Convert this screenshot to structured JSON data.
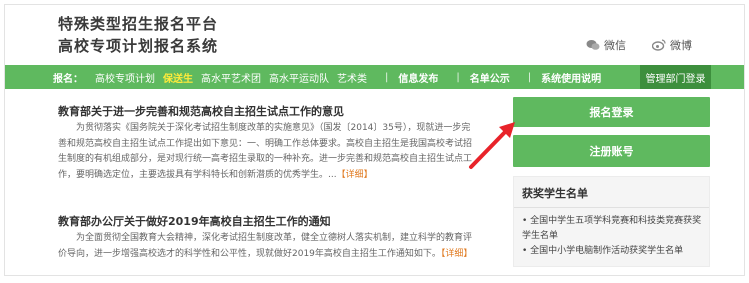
{
  "header": {
    "title_line1": "特殊类型招生报名平台",
    "title_line2": "高校专项计划报名系统",
    "wechat_label": "微信",
    "weibo_label": "微博"
  },
  "nav": {
    "prefix": "报名：",
    "items": [
      {
        "label": "高校专项计划",
        "active": false
      },
      {
        "label": "保送生",
        "active": true
      },
      {
        "label": "高水平艺术团",
        "active": false
      },
      {
        "label": "高水平运动队",
        "active": false
      },
      {
        "label": "艺术类",
        "active": false
      }
    ],
    "separator": "|",
    "info": "信息发布",
    "list": "名单公示",
    "guide": "系统使用说明",
    "admin": "管理部门登录"
  },
  "articles": [
    {
      "title": "教育部关于进一步完善和规范高校自主招生试点工作的意见",
      "body": "为贯彻落实《国务院关于深化考试招生制度改革的实施意见》（国发〔2014〕35号），现就进一步完善和规范高校自主招生试点工作提出如下意见：一、明确工作总体要求。高校自主招生是我国高校考试招生制度的有机组成部分，是对现行统一高考招生录取的一种补充。进一步完善和规范高校自主招生试点工作，要明确选定位，主要选拔具有学科特长和创新潜质的优秀学生。...",
      "more": "【详细】"
    },
    {
      "title": "教育部办公厅关于做好2019年高校自主招生工作的通知",
      "body": "为全面贯彻全国教育大会精神，深化考试招生制度改革，健全立德树人落实机制，建立科学的教育评价导向，进一步增强高校选才的科学性和公平性，现就做好2019年高校自主招生工作通知如下。",
      "more": "【详细】"
    }
  ],
  "sidebar": {
    "register_btn": "报名登录",
    "account_btn": "注册账号",
    "awards_title": "获奖学生名单",
    "awards": [
      "• 全国中学生五项学科竞赛和科技类竞赛获奖学生名单",
      "• 全国中小学电脑制作活动获奖学生名单"
    ]
  },
  "colors": {
    "green": "#5fb95f",
    "dark_green": "#3d8f3d",
    "active_nav": "#ffeb3b",
    "more_link": "#e07b22",
    "arrow": "#e8232a"
  }
}
